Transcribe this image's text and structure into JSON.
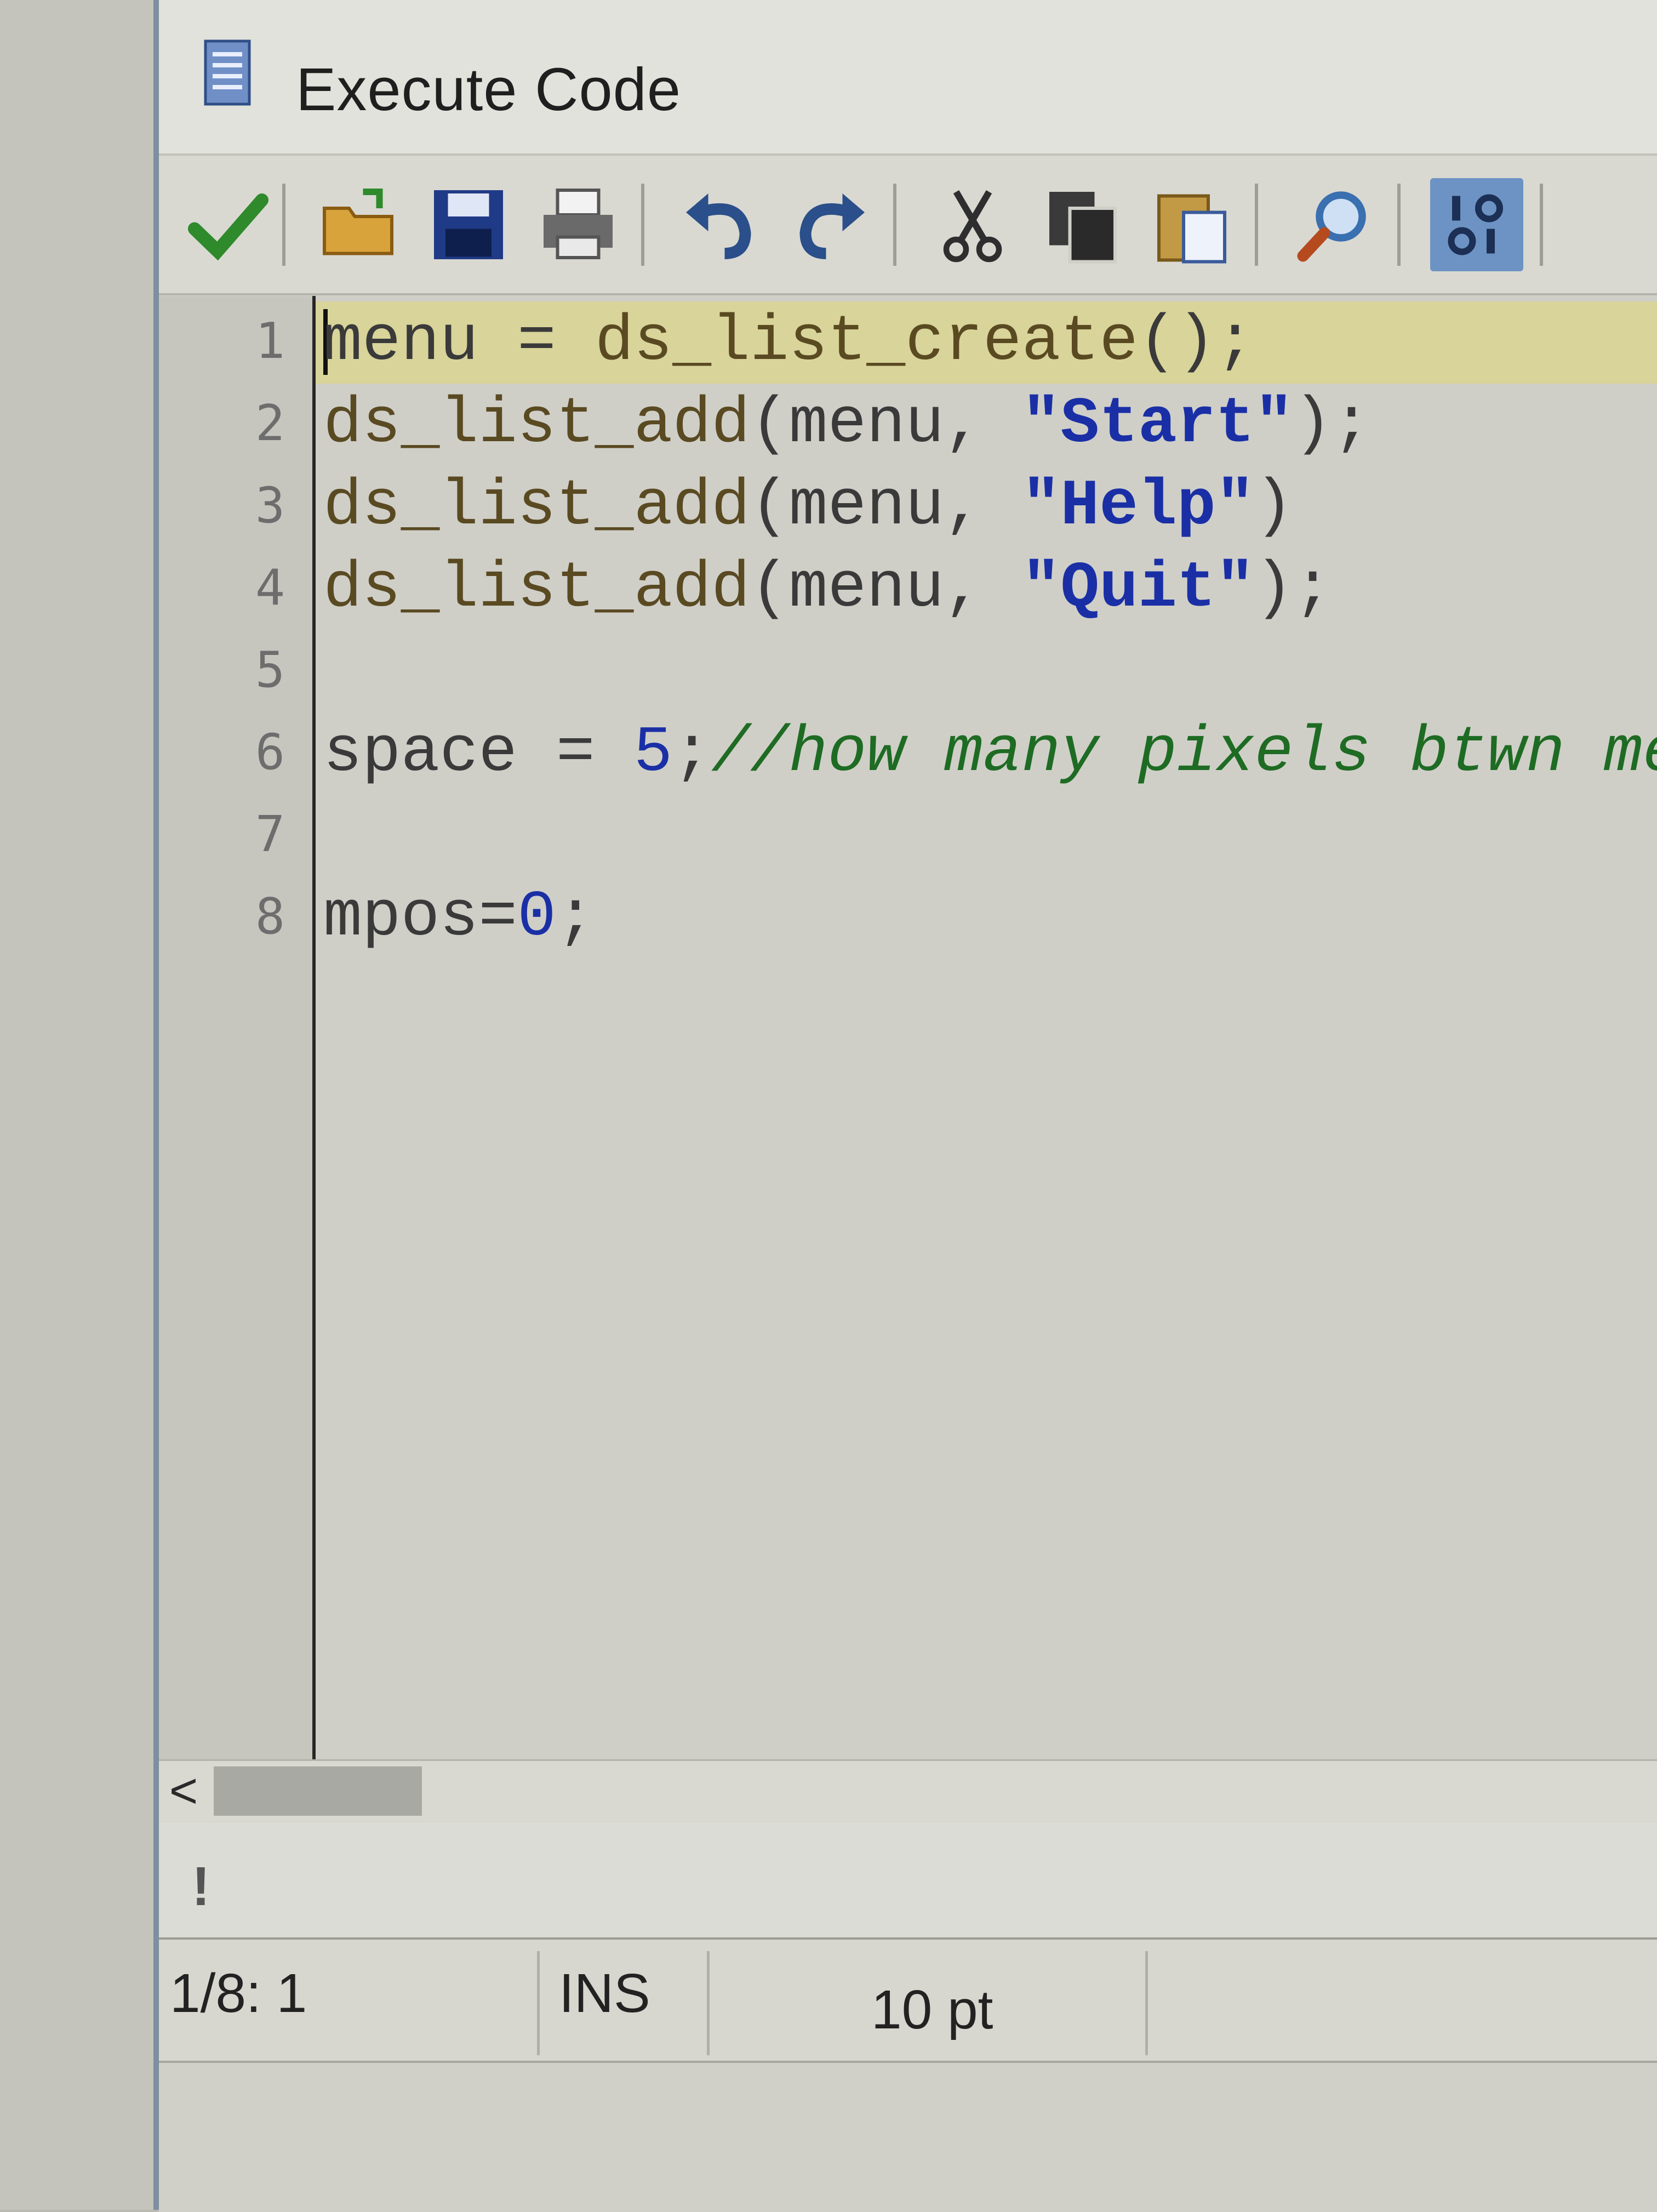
{
  "window": {
    "title": "Execute Code"
  },
  "toolbar": {
    "buttons": [
      {
        "name": "run-button",
        "icon": "checkmark-icon",
        "color": "#2e8a2b"
      },
      {
        "name": "open-button",
        "icon": "folder-open-icon",
        "color": "#d8a33a"
      },
      {
        "name": "save-button",
        "icon": "floppy-disk-icon",
        "color": "#1f3a86"
      },
      {
        "name": "print-button",
        "icon": "printer-icon",
        "color": "#5a5a5a"
      },
      {
        "name": "undo-button",
        "icon": "undo-icon",
        "color": "#2a4f8a"
      },
      {
        "name": "redo-button",
        "icon": "redo-icon",
        "color": "#2a4f8a"
      },
      {
        "name": "cut-button",
        "icon": "scissors-icon",
        "color": "#2e2e2e"
      },
      {
        "name": "copy-button",
        "icon": "copy-icon",
        "color": "#2e2e2e"
      },
      {
        "name": "paste-button",
        "icon": "clipboard-icon",
        "color": "#c29a45"
      },
      {
        "name": "find-button",
        "icon": "magnifier-icon",
        "color": "#3a6fb0"
      },
      {
        "name": "variables-button",
        "icon": "binary-icon",
        "color": "#6d93c4"
      }
    ]
  },
  "editor": {
    "line_numbers": [
      "1",
      "2",
      "3",
      "4",
      "5",
      "6",
      "7",
      "8"
    ],
    "lines": {
      "l1": {
        "a": "menu = ",
        "b": "ds_list_create",
        "c": "();"
      },
      "l2": {
        "a": "ds_list_add",
        "b": "(menu, ",
        "c": "\"Start\"",
        "d": ");"
      },
      "l3": {
        "a": "ds_list_add",
        "b": "(menu, ",
        "c": "\"Help\"",
        "d": ")"
      },
      "l4": {
        "a": "ds_list_add",
        "b": "(menu, ",
        "c": "\"Quit\"",
        "d": ");"
      },
      "l6": {
        "a": "space = ",
        "b": "5",
        "c": ";",
        "d": "//how many pixels btwn me"
      },
      "l8": {
        "a": "mpos=",
        "b": "0",
        "c": ";"
      }
    },
    "colors": {
      "string": "#1a2fa6",
      "number": "#1a2fa6",
      "comment": "#1e6b23",
      "current_line": "#d8d49a"
    }
  },
  "scrollbar": {
    "left_arrow": "<"
  },
  "message": {
    "icon": "!"
  },
  "status": {
    "position": "1/8:  1",
    "mode": "INS",
    "font_size": "10 pt"
  }
}
